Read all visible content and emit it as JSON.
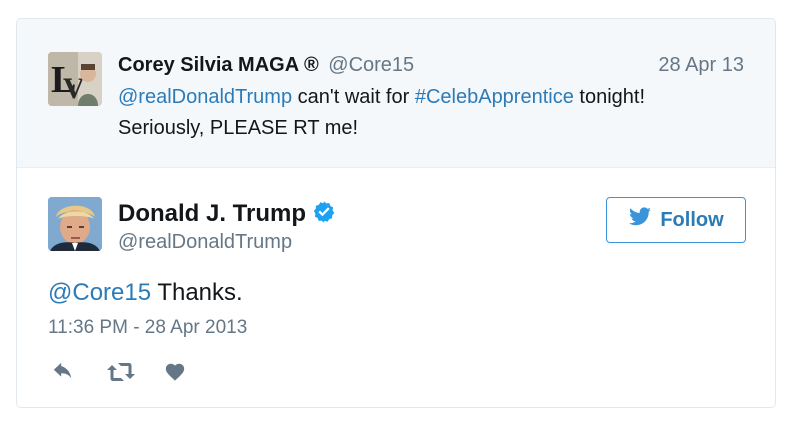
{
  "parent_tweet": {
    "display_name": "Corey Silvia MAGA ®",
    "handle": "@Core15",
    "date": "28 Apr 13",
    "mention": "@realDonaldTrump",
    "text_part1": " can't wait for ",
    "hashtag": "#CelebApprentice",
    "text_part2": " tonight!",
    "text_line2": "Seriously, PLEASE RT me!"
  },
  "tweet": {
    "display_name": "Donald J. Trump",
    "handle": "@realDonaldTrump",
    "follow_label": "Follow",
    "mention": "@Core15",
    "text": " Thanks.",
    "timestamp": "11:36 PM - 28 Apr 2013"
  },
  "icons": {
    "verified": "verified-badge-icon",
    "follow": "twitter-bird-icon",
    "actions": [
      "reply-icon",
      "retweet-icon",
      "like-icon"
    ]
  },
  "colors": {
    "link": "#2b7bb9",
    "verified": "#1da1f2",
    "muted": "#657786",
    "text": "#14171a",
    "parent_bg": "#f5f8fa"
  }
}
